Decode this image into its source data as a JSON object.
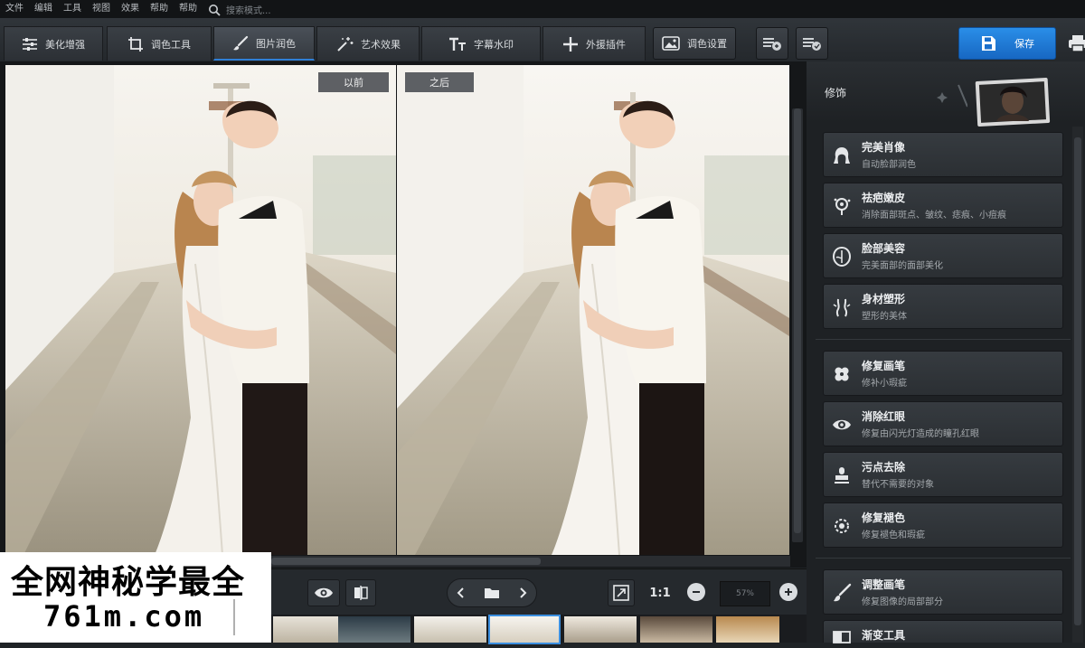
{
  "menubar": {
    "items": [
      "文件",
      "编辑",
      "工具",
      "视图",
      "效果",
      "帮助",
      "帮助"
    ],
    "search_placeholder": "搜索模式..."
  },
  "toolbar": {
    "tabs": [
      {
        "label": "美化增强",
        "icon": "sliders-icon"
      },
      {
        "label": "调色工具",
        "icon": "crop-icon"
      },
      {
        "label": "图片润色",
        "icon": "brush-icon"
      },
      {
        "label": "艺术效果",
        "icon": "magic-wand-icon"
      },
      {
        "label": "字幕水印",
        "icon": "text-icon"
      },
      {
        "label": "外援插件",
        "icon": "plus-icon"
      },
      {
        "label": "调色设置",
        "icon": "image-icon"
      }
    ],
    "active_tab": 2,
    "save_label": "保存"
  },
  "compare": {
    "before_label": "以前",
    "after_label": "之后"
  },
  "bottombar": {
    "ratio_label": "1:1",
    "zoom_value": "57%"
  },
  "watermark": {
    "line1": "全网神秘学最全",
    "line2": "761m.com"
  },
  "sidebar": {
    "title": "修饰",
    "tools": [
      {
        "name": "完美肖像",
        "desc": "自动脸部润色",
        "icon": "portrait-icon"
      },
      {
        "name": "祛疤嫩皮",
        "desc": "消除面部斑点、皱纹、痣痕、小痘痕",
        "icon": "skin-care-icon"
      },
      {
        "name": "脸部美容",
        "desc": "完美面部的面部美化",
        "icon": "face-shape-icon"
      },
      {
        "name": "身材塑形",
        "desc": "塑形的美体",
        "icon": "body-shape-icon"
      },
      {
        "name": "修复画笔",
        "desc": "修补小瑕疵",
        "icon": "bandage-icon"
      },
      {
        "name": "消除红眼",
        "desc": "修复由闪光灯造成的瞳孔红眼",
        "icon": "eye-icon"
      },
      {
        "name": "污点去除",
        "desc": "替代不需要的对象",
        "icon": "stamp-icon"
      },
      {
        "name": "修复褪色",
        "desc": "修复褪色和瑕疵",
        "icon": "restore-icon"
      },
      {
        "name": "调整画笔",
        "desc": "修复图像的局部部分",
        "icon": "adjust-brush-icon"
      },
      {
        "name": "渐变工具",
        "desc": "",
        "icon": "gradient-icon"
      }
    ]
  },
  "colors": {
    "accent": "#2a8ee8",
    "panel": "#2b2f33",
    "background": "#1f2326"
  }
}
